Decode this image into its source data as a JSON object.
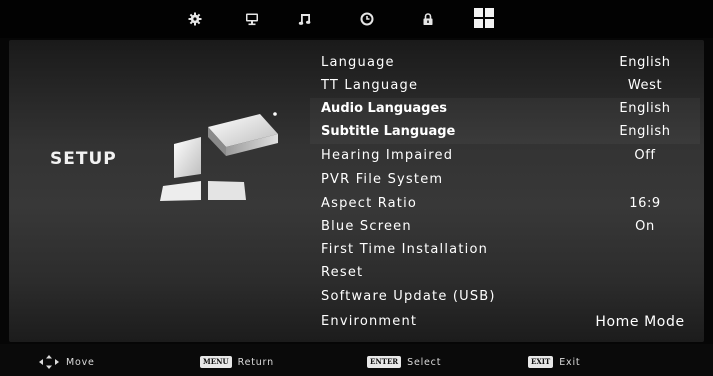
{
  "tabs": [
    {
      "icon": "gear-icon"
    },
    {
      "icon": "monitor-icon"
    },
    {
      "icon": "music-note-icon"
    },
    {
      "icon": "clock-icon"
    },
    {
      "icon": "lock-icon"
    },
    {
      "icon": "app-grid-icon"
    }
  ],
  "sidebar": {
    "title": "SETUP"
  },
  "menu": {
    "items": [
      {
        "label": "Language",
        "value": "English"
      },
      {
        "label": "TT Language",
        "value": "West"
      },
      {
        "label": "Audio Languages",
        "value": "English"
      },
      {
        "label": "Subtitle Language",
        "value": "English"
      },
      {
        "label": "Hearing Impaired",
        "value": "Off"
      },
      {
        "label": "PVR File System",
        "value": ""
      },
      {
        "label": "Aspect Ratio",
        "value": "16:9"
      },
      {
        "label": "Blue Screen",
        "value": "On"
      },
      {
        "label": "First Time Installation",
        "value": ""
      },
      {
        "label": "Reset",
        "value": ""
      },
      {
        "label": "Software Update (USB)",
        "value": ""
      },
      {
        "label": "Environment",
        "value": "Home Mode"
      }
    ]
  },
  "help_bar": {
    "move": {
      "text": "Move"
    },
    "return": {
      "key": "MENU",
      "text": "Return"
    },
    "select": {
      "key": "ENTER",
      "text": "Select"
    },
    "exit": {
      "key": "EXIT",
      "text": "Exit"
    }
  }
}
